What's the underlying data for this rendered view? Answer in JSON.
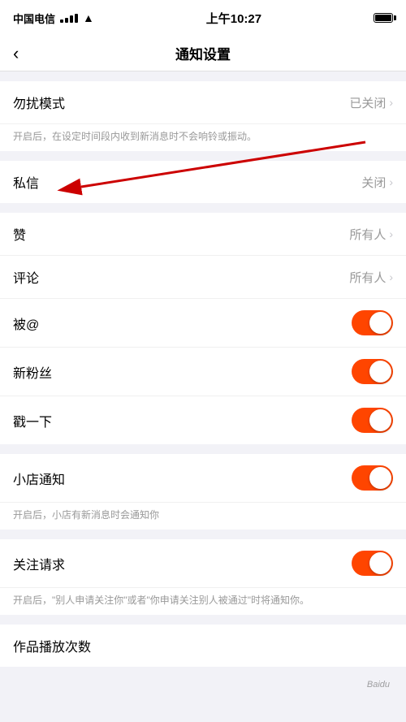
{
  "statusBar": {
    "carrier": "中国电信",
    "time": "上午10:27"
  },
  "navBar": {
    "title": "通知设置",
    "backLabel": "‹"
  },
  "sections": [
    {
      "id": "dnd",
      "items": [
        {
          "label": "勿扰模式",
          "valueText": "已关闭",
          "hasArrow": true,
          "hasToggle": false,
          "toggleOn": false
        }
      ],
      "note": "开启后，在设定时间段内收到新消息时不会响铃或振动。"
    },
    {
      "id": "private",
      "items": [
        {
          "label": "私信",
          "valueText": "关闭",
          "hasArrow": true,
          "hasToggle": false,
          "toggleOn": false
        }
      ],
      "note": null
    },
    {
      "id": "interactions",
      "items": [
        {
          "label": "赞",
          "valueText": "所有人",
          "hasArrow": true,
          "hasToggle": false,
          "toggleOn": false,
          "annotated": true
        },
        {
          "label": "评论",
          "valueText": "所有人",
          "hasArrow": true,
          "hasToggle": false,
          "toggleOn": false
        },
        {
          "label": "被@",
          "valueText": null,
          "hasArrow": false,
          "hasToggle": true,
          "toggleOn": true
        },
        {
          "label": "新粉丝",
          "valueText": null,
          "hasArrow": false,
          "hasToggle": true,
          "toggleOn": true
        },
        {
          "label": "戳一下",
          "valueText": null,
          "hasArrow": false,
          "hasToggle": true,
          "toggleOn": true
        }
      ],
      "note": null
    },
    {
      "id": "shop",
      "items": [
        {
          "label": "小店通知",
          "valueText": null,
          "hasArrow": false,
          "hasToggle": true,
          "toggleOn": true
        }
      ],
      "note": "开启后，小店有新消息时会通知你"
    },
    {
      "id": "follow",
      "items": [
        {
          "label": "关注请求",
          "valueText": null,
          "hasArrow": false,
          "hasToggle": true,
          "toggleOn": true
        }
      ],
      "note": "开启后，\"别人申请关注你\"或者\"你申请关注别人被通过\"时将通知你。"
    },
    {
      "id": "plays",
      "items": [
        {
          "label": "作品播放次数",
          "valueText": null,
          "hasArrow": false,
          "hasToggle": false,
          "toggleOn": false
        }
      ],
      "note": null
    }
  ],
  "watermark": "Baidu"
}
